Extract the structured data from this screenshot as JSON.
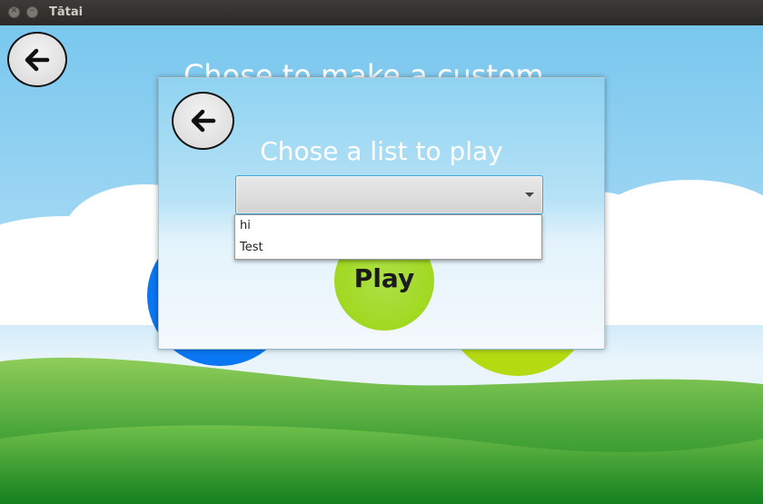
{
  "window": {
    "title": "Tātai"
  },
  "background": {
    "heading": "Chose to make a custom"
  },
  "dialog": {
    "title": "Chose a list to play",
    "select": {
      "value": "",
      "options": [
        "hi",
        "Test"
      ]
    },
    "play_label": "Play"
  },
  "icons": {
    "back": "arrow-left-icon",
    "caret": "caret-down-icon",
    "close": "close-icon",
    "minimize": "minimize-icon"
  },
  "colors": {
    "blue_circle": "#0a77f2",
    "green_circle": "#b4da12",
    "play_button": "#9bd50f",
    "select_focus": "#3ba6d8"
  }
}
